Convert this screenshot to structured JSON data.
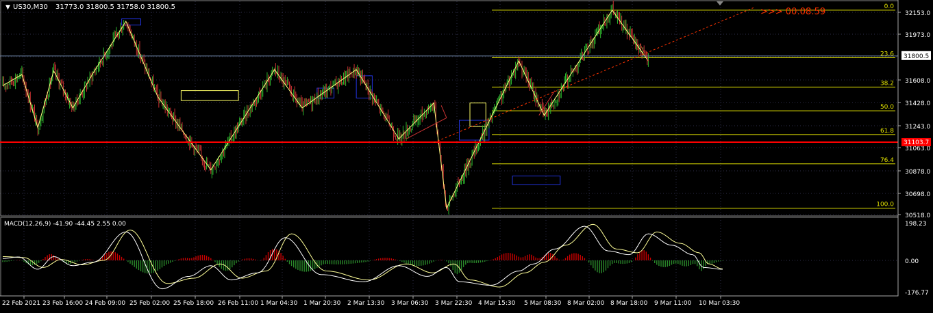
{
  "window": {
    "symbol_label": "US30,M30",
    "ohlc_label": "31773.0 31800.5 31758.0 31800.5",
    "countdown": ">>> 00:08:59",
    "current_price_label": "31800.5",
    "support_price_label": "31103.7"
  },
  "colors": {
    "background": "#000000",
    "axis_text": "#ffffff",
    "grid": "#2e2e4a",
    "bull_candle": "#2eb82e",
    "bear_candle": "#cc3333",
    "zigzag": "#ffff80",
    "fib": "#e6e600",
    "support": "#ff0000",
    "countdown": "#ff3300",
    "trend_dotted": "#ff3300",
    "macd_line": "#ffffff",
    "signal_line": "#ffff99",
    "hist_pos": "#cc0000",
    "hist_neg": "#2a8a2a",
    "box_blue": "#2233dd",
    "box_yellow": "#ffff66"
  },
  "chart_data": [
    {
      "type": "candlestick",
      "title": "US30,M30",
      "symbol": "US30",
      "timeframe": "M30",
      "last_bar_ohlc": {
        "open": 31773.0,
        "high": 31800.5,
        "low": 31758.0,
        "close": 31800.5
      },
      "ylim": [
        30518,
        32240
      ],
      "y_ticks": [
        "32153.0",
        "31973.0",
        "31800.5",
        "31608.0",
        "31428.0",
        "31243.0",
        "31063.0",
        "30878.0",
        "30698.0",
        "30518.0"
      ],
      "x_ticks": [
        "22 Feb 2021",
        "23 Feb 16:00",
        "24 Feb 09:00",
        "25 Feb 02:00",
        "25 Feb 18:00",
        "26 Feb 11:00",
        "1 Mar 04:30",
        "1 Mar 20:30",
        "2 Mar 13:30",
        "3 Mar 06:30",
        "3 Mar 22:30",
        "4 Mar 15:30",
        "5 Mar 08:30",
        "8 Mar 02:00",
        "8 Mar 18:00",
        "9 Mar 11:00",
        "10 Mar 03:30"
      ],
      "zigzag_points": [
        {
          "bar": 0,
          "price": 31560
        },
        {
          "bar": 18,
          "price": 31650
        },
        {
          "bar": 33,
          "price": 31220
        },
        {
          "bar": 48,
          "price": 31680
        },
        {
          "bar": 66,
          "price": 31380
        },
        {
          "bar": 85,
          "price": 31660
        },
        {
          "bar": 116,
          "price": 32080
        },
        {
          "bar": 146,
          "price": 31470
        },
        {
          "bar": 196,
          "price": 30880
        },
        {
          "bar": 256,
          "price": 31690
        },
        {
          "bar": 282,
          "price": 31380
        },
        {
          "bar": 333,
          "price": 31690
        },
        {
          "bar": 373,
          "price": 31130
        },
        {
          "bar": 406,
          "price": 31420
        },
        {
          "bar": 418,
          "price": 30570
        },
        {
          "bar": 486,
          "price": 31760
        },
        {
          "bar": 510,
          "price": 31320
        },
        {
          "bar": 574,
          "price": 32170
        },
        {
          "bar": 608,
          "price": 31760
        }
      ],
      "fibonacci": {
        "levels": [
          {
            "ratio": 0.0,
            "label": "0.0",
            "price": 32170
          },
          {
            "ratio": 0.236,
            "label": "23.6",
            "price": 31786
          },
          {
            "ratio": 0.382,
            "label": "38.2",
            "price": 31549
          },
          {
            "ratio": 0.5,
            "label": "50.0",
            "price": 31357
          },
          {
            "ratio": 0.618,
            "label": "61.8",
            "price": 31165
          },
          {
            "ratio": 0.764,
            "label": "76.4",
            "price": 30928
          },
          {
            "ratio": 1.0,
            "label": "100.0",
            "price": 30570
          }
        ]
      },
      "support_line": 31103.7,
      "current_price": 31800.5
    },
    {
      "type": "line",
      "title": "MACD(12,26,9) -41.90 -44.45 2.55 0.00",
      "indicator": "MACD",
      "params": [
        12,
        26,
        9
      ],
      "values": {
        "macd": -41.9,
        "signal": -44.45,
        "histogram": 2.55,
        "extra": 0.0
      },
      "ylim": [
        -176.77,
        198.23
      ],
      "y_ticks": [
        "198.23",
        "0.00",
        "-176.77"
      ],
      "series": [
        {
          "name": "MACD",
          "anchors": [
            [
              0,
              10
            ],
            [
              15,
              18
            ],
            [
              33,
              -50
            ],
            [
              48,
              20
            ],
            [
              66,
              -30
            ],
            [
              85,
              -10
            ],
            [
              116,
              150
            ],
            [
              150,
              -160
            ],
            [
              175,
              -90
            ],
            [
              196,
              -30
            ],
            [
              215,
              -110
            ],
            [
              240,
              -70
            ],
            [
              266,
              120
            ],
            [
              300,
              -80
            ],
            [
              340,
              -120
            ],
            [
              373,
              -30
            ],
            [
              400,
              -90
            ],
            [
              418,
              -40
            ],
            [
              430,
              -120
            ],
            [
              460,
              -140
            ],
            [
              486,
              -60
            ],
            [
              500,
              -20
            ],
            [
              520,
              60
            ],
            [
              548,
              180
            ],
            [
              570,
              50
            ],
            [
              590,
              30
            ],
            [
              608,
              140
            ],
            [
              630,
              80
            ],
            [
              650,
              30
            ],
            [
              660,
              -40
            ],
            [
              678,
              -50
            ]
          ]
        },
        {
          "name": "Signal",
          "anchors": [
            [
              0,
              20
            ],
            [
              20,
              15
            ],
            [
              38,
              -40
            ],
            [
              55,
              5
            ],
            [
              75,
              -25
            ],
            [
              95,
              0
            ],
            [
              120,
              160
            ],
            [
              155,
              -130
            ],
            [
              180,
              -100
            ],
            [
              205,
              -20
            ],
            [
              225,
              -100
            ],
            [
              248,
              -60
            ],
            [
              272,
              140
            ],
            [
              305,
              -60
            ],
            [
              345,
              -110
            ],
            [
              380,
              -20
            ],
            [
              405,
              -70
            ],
            [
              425,
              -20
            ],
            [
              440,
              -110
            ],
            [
              468,
              -150
            ],
            [
              492,
              -70
            ],
            [
              510,
              -10
            ],
            [
              530,
              80
            ],
            [
              556,
              190
            ],
            [
              578,
              60
            ],
            [
              598,
              40
            ],
            [
              616,
              150
            ],
            [
              638,
              90
            ],
            [
              656,
              40
            ],
            [
              665,
              -20
            ],
            [
              678,
              -48
            ]
          ]
        }
      ]
    }
  ]
}
